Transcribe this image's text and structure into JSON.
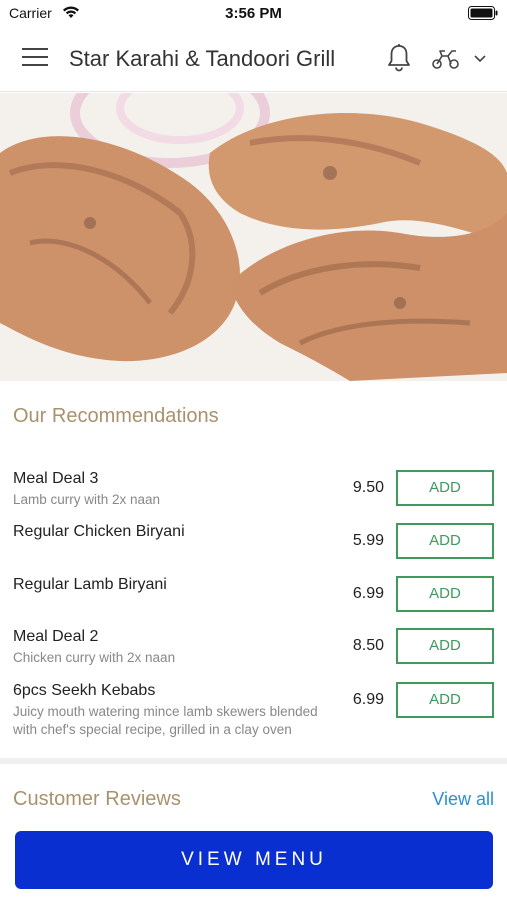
{
  "status_bar": {
    "carrier": "Carrier",
    "time": "3:56 PM"
  },
  "header": {
    "title": "Star Karahi & Tandoori Grill",
    "icons": [
      "menu-icon",
      "bell-icon",
      "scooter-icon",
      "chevron-down-icon"
    ]
  },
  "recommendations": {
    "title": "Our Recommendations",
    "add_label": "ADD",
    "items": [
      {
        "name": "Meal Deal 3",
        "desc": "Lamb curry with 2x naan",
        "price": "9.50"
      },
      {
        "name": "Regular Chicken Biryani",
        "desc": "",
        "price": "5.99"
      },
      {
        "name": "Regular Lamb Biryani",
        "desc": "",
        "price": "6.99"
      },
      {
        "name": "Meal Deal 2",
        "desc": "Chicken curry with 2x naan",
        "price": "8.50"
      },
      {
        "name": "6pcs Seekh Kebabs",
        "desc": "Juicy mouth watering mince lamb skewers blended with chef's special recipe, grilled in a clay oven",
        "price": "6.99"
      }
    ]
  },
  "reviews": {
    "title": "Customer Reviews",
    "view_all": "View all"
  },
  "footer": {
    "view_menu": "VIEW MENU"
  },
  "colors": {
    "section_title": "#a8926e",
    "add_green": "#3f9a5c",
    "link_blue": "#2b8fd0",
    "primary_button": "#0a2fd0"
  }
}
